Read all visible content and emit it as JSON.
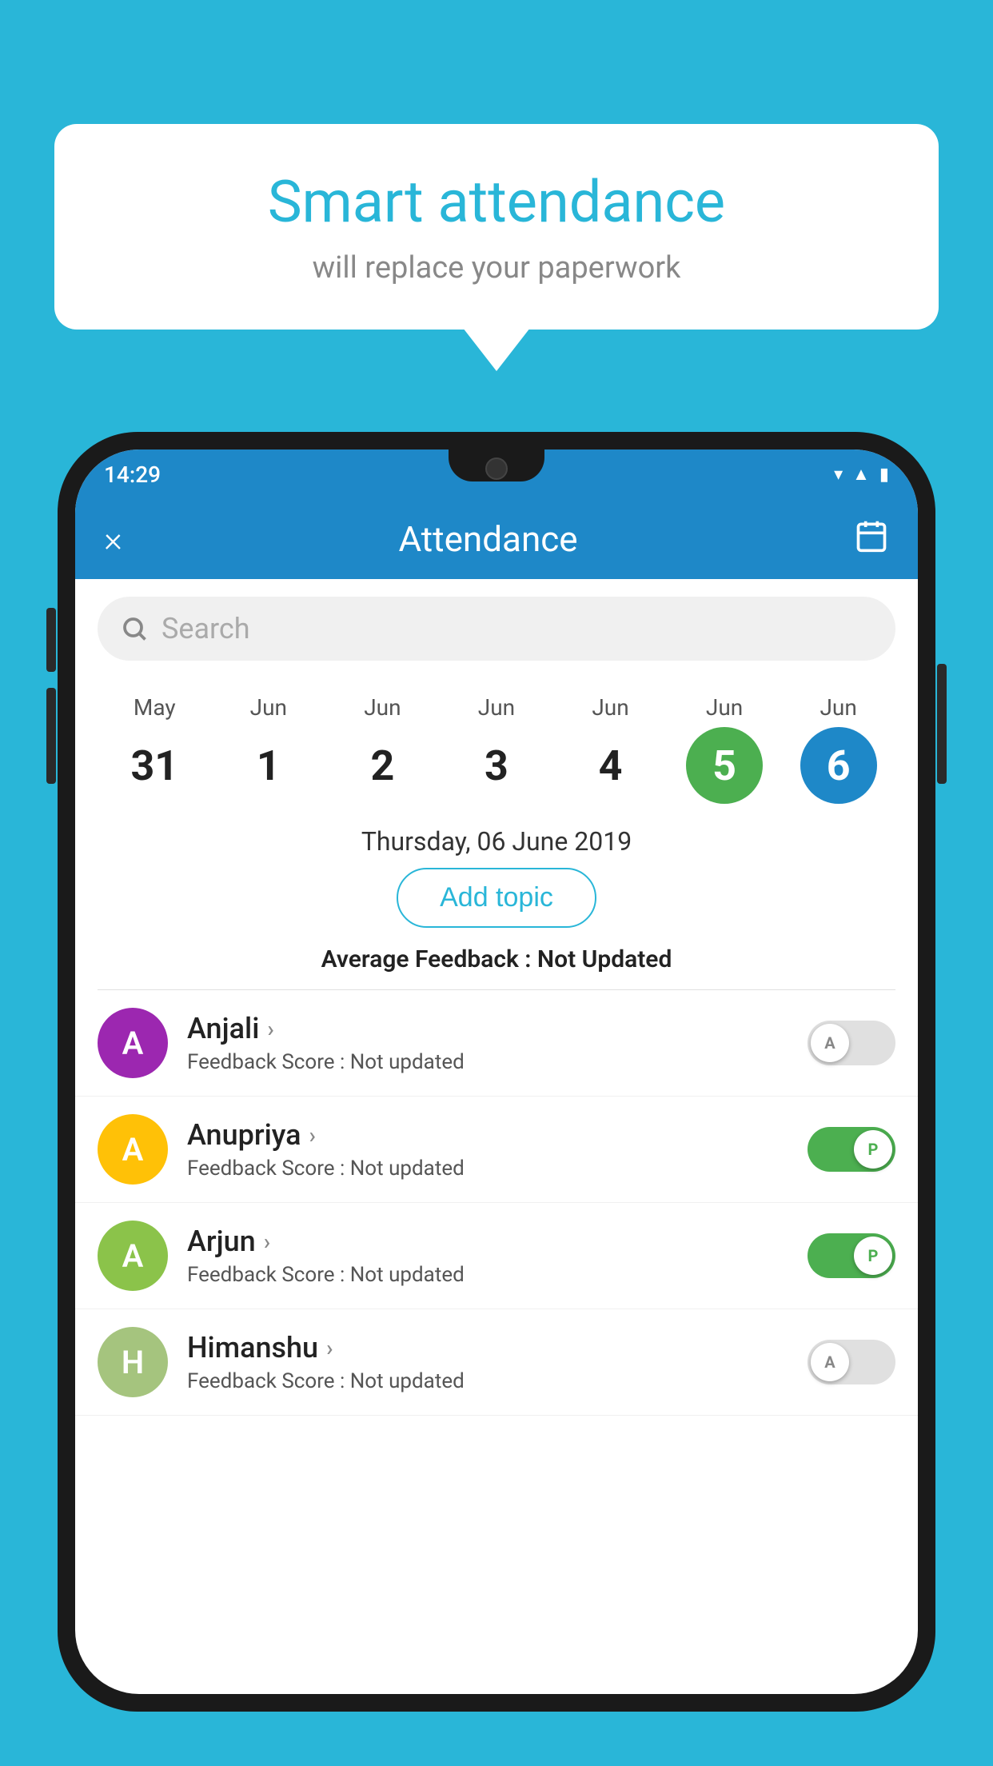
{
  "background": {
    "color": "#29b6d8"
  },
  "speech_bubble": {
    "title": "Smart attendance",
    "subtitle": "will replace your paperwork"
  },
  "status_bar": {
    "time": "14:29"
  },
  "header": {
    "title": "Attendance",
    "close_label": "×",
    "calendar_icon": "📅"
  },
  "search": {
    "placeholder": "Search"
  },
  "dates": [
    {
      "month": "May",
      "day": "31",
      "state": "normal"
    },
    {
      "month": "Jun",
      "day": "1",
      "state": "normal"
    },
    {
      "month": "Jun",
      "day": "2",
      "state": "normal"
    },
    {
      "month": "Jun",
      "day": "3",
      "state": "normal"
    },
    {
      "month": "Jun",
      "day": "4",
      "state": "normal"
    },
    {
      "month": "Jun",
      "day": "5",
      "state": "today"
    },
    {
      "month": "Jun",
      "day": "6",
      "state": "selected"
    }
  ],
  "selected_date": "Thursday, 06 June 2019",
  "add_topic_label": "Add topic",
  "avg_feedback": {
    "label": "Average Feedback : ",
    "value": "Not Updated"
  },
  "students": [
    {
      "name": "Anjali",
      "avatar_letter": "A",
      "avatar_color": "#9c27b0",
      "feedback_label": "Feedback Score : ",
      "feedback_value": "Not updated",
      "attendance": "absent",
      "toggle_letter": "A"
    },
    {
      "name": "Anupriya",
      "avatar_letter": "A",
      "avatar_color": "#ffc107",
      "feedback_label": "Feedback Score : ",
      "feedback_value": "Not updated",
      "attendance": "present",
      "toggle_letter": "P"
    },
    {
      "name": "Arjun",
      "avatar_letter": "A",
      "avatar_color": "#8bc34a",
      "feedback_label": "Feedback Score : ",
      "feedback_value": "Not updated",
      "attendance": "present",
      "toggle_letter": "P"
    },
    {
      "name": "Himanshu",
      "avatar_letter": "H",
      "avatar_color": "#a5c47e",
      "feedback_label": "Feedback Score : ",
      "feedback_value": "Not updated",
      "attendance": "absent",
      "toggle_letter": "A"
    }
  ]
}
